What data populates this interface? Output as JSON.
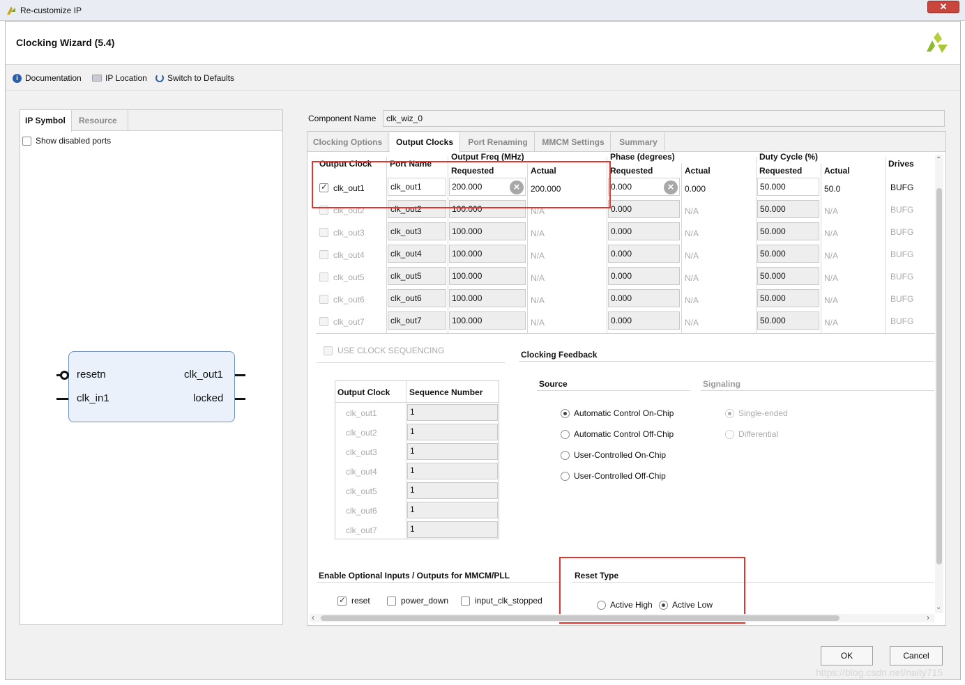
{
  "window": {
    "title": "Re-customize IP",
    "close": "✕"
  },
  "dialog": {
    "title": "Clocking Wizard (5.4)"
  },
  "toolbar": {
    "documentation": "Documentation",
    "ip_location": "IP Location",
    "switch_defaults": "Switch to Defaults"
  },
  "left": {
    "tabs": [
      "IP Symbol",
      "Resource"
    ],
    "show_disabled_ports": "Show disabled ports",
    "symbol": {
      "in_ports": [
        "resetn",
        "clk_in1"
      ],
      "out_ports": [
        "clk_out1",
        "locked"
      ]
    }
  },
  "component": {
    "label": "Component Name",
    "value": "clk_wiz_0"
  },
  "tabs": [
    "Clocking Options",
    "Output Clocks",
    "Port Renaming",
    "MMCM Settings",
    "Summary"
  ],
  "grid": {
    "headers": {
      "output_clock": "Output Clock",
      "port_name": "Port Name",
      "output_freq": "Output Freq (MHz)",
      "phase": "Phase (degrees)",
      "duty": "Duty Cycle (%)",
      "requested": "Requested",
      "actual": "Actual",
      "drives": "Drives"
    },
    "rows": [
      {
        "enabled": true,
        "clock": "clk_out1",
        "port": "clk_out1",
        "freq_req": "200.000",
        "freq_act": "200.000",
        "phase_req": "0.000",
        "phase_act": "0.000",
        "duty_req": "50.000",
        "duty_act": "50.0",
        "drives": "BUFG"
      },
      {
        "enabled": false,
        "clock": "clk_out2",
        "port": "clk_out2",
        "freq_req": "100.000",
        "freq_act": "N/A",
        "phase_req": "0.000",
        "phase_act": "N/A",
        "duty_req": "50.000",
        "duty_act": "N/A",
        "drives": "BUFG"
      },
      {
        "enabled": false,
        "clock": "clk_out3",
        "port": "clk_out3",
        "freq_req": "100.000",
        "freq_act": "N/A",
        "phase_req": "0.000",
        "phase_act": "N/A",
        "duty_req": "50.000",
        "duty_act": "N/A",
        "drives": "BUFG"
      },
      {
        "enabled": false,
        "clock": "clk_out4",
        "port": "clk_out4",
        "freq_req": "100.000",
        "freq_act": "N/A",
        "phase_req": "0.000",
        "phase_act": "N/A",
        "duty_req": "50.000",
        "duty_act": "N/A",
        "drives": "BUFG"
      },
      {
        "enabled": false,
        "clock": "clk_out5",
        "port": "clk_out5",
        "freq_req": "100.000",
        "freq_act": "N/A",
        "phase_req": "0.000",
        "phase_act": "N/A",
        "duty_req": "50.000",
        "duty_act": "N/A",
        "drives": "BUFG"
      },
      {
        "enabled": false,
        "clock": "clk_out6",
        "port": "clk_out6",
        "freq_req": "100.000",
        "freq_act": "N/A",
        "phase_req": "0.000",
        "phase_act": "N/A",
        "duty_req": "50.000",
        "duty_act": "N/A",
        "drives": "BUFG"
      },
      {
        "enabled": false,
        "clock": "clk_out7",
        "port": "clk_out7",
        "freq_req": "100.000",
        "freq_act": "N/A",
        "phase_req": "0.000",
        "phase_act": "N/A",
        "duty_req": "50.000",
        "duty_act": "N/A",
        "drives": "BUFG"
      }
    ]
  },
  "sequencing": {
    "checkbox": "USE CLOCK SEQUENCING",
    "headers": [
      "Output Clock",
      "Sequence Number"
    ],
    "rows": [
      {
        "clock": "clk_out1",
        "seq": "1"
      },
      {
        "clock": "clk_out2",
        "seq": "1"
      },
      {
        "clock": "clk_out3",
        "seq": "1"
      },
      {
        "clock": "clk_out4",
        "seq": "1"
      },
      {
        "clock": "clk_out5",
        "seq": "1"
      },
      {
        "clock": "clk_out6",
        "seq": "1"
      },
      {
        "clock": "clk_out7",
        "seq": "1"
      }
    ]
  },
  "feedback": {
    "title": "Clocking Feedback",
    "source_title": "Source",
    "source_options": [
      "Automatic Control On-Chip",
      "Automatic Control Off-Chip",
      "User-Controlled On-Chip",
      "User-Controlled Off-Chip"
    ],
    "source_selected": 0,
    "signaling_title": "Signaling",
    "signaling_options": [
      "Single-ended",
      "Differential"
    ],
    "signaling_selected": 0
  },
  "optional": {
    "title": "Enable Optional Inputs / Outputs for MMCM/PLL",
    "items": [
      {
        "label": "reset",
        "checked": true
      },
      {
        "label": "power_down",
        "checked": false
      },
      {
        "label": "input_clk_stopped",
        "checked": false
      }
    ]
  },
  "reset": {
    "title": "Reset Type",
    "options": [
      "Active High",
      "Active Low"
    ],
    "selected": 1
  },
  "buttons": {
    "ok": "OK",
    "cancel": "Cancel"
  },
  "watermark": "https://blog.csdn.net/naity715",
  "colors": {
    "highlight_red": "#e8312b",
    "symbol_fill": "#eaf1fb",
    "logo_green": "#8db92e"
  }
}
